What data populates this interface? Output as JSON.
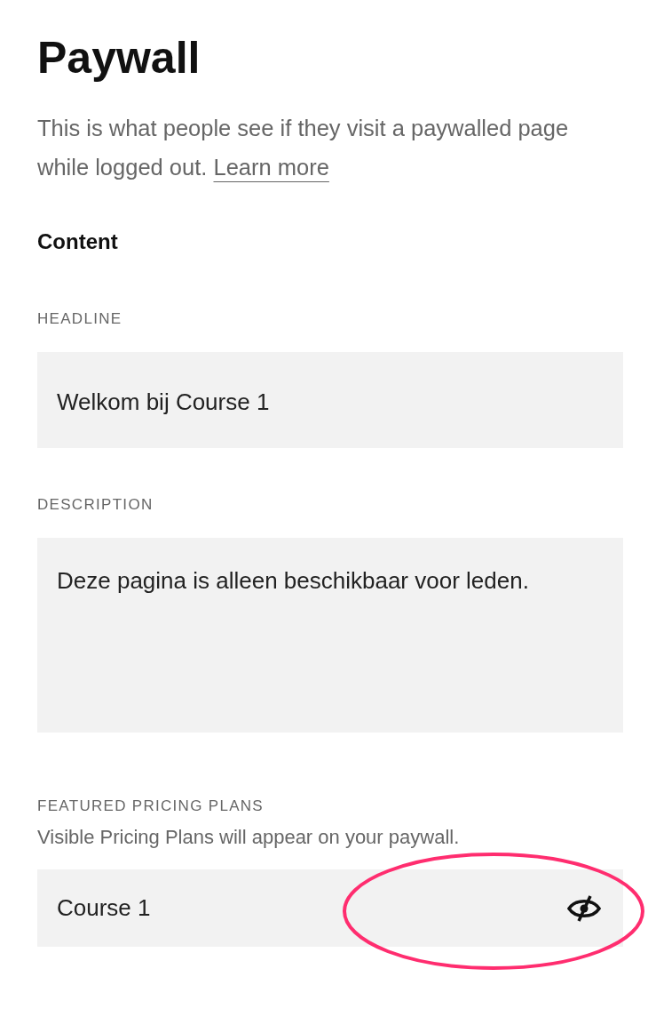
{
  "title": "Paywall",
  "intro": {
    "text": "This is what people see if they visit a paywalled page while logged out.",
    "link": "Learn more"
  },
  "section": "Content",
  "fields": [
    {
      "kind": "input",
      "label": "HEADLINE",
      "value": "Welkom bij Course 1"
    },
    {
      "kind": "textarea",
      "label": "DESCRIPTION",
      "value": "Deze pagina is alleen beschikbaar voor leden."
    }
  ],
  "pricing": {
    "label": "FEATURED PRICING PLANS",
    "help": "Visible Pricing Plans will appear on your paywall.",
    "plans": [
      {
        "name": "Course 1",
        "visible": false,
        "highlighted": true
      }
    ]
  }
}
